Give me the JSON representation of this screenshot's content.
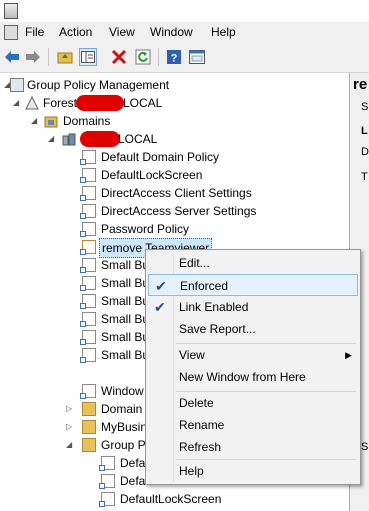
{
  "menu": {
    "file": "File",
    "action": "Action",
    "view": "View",
    "window": "Window",
    "help": "Help"
  },
  "toolbar_icons": [
    "back-arrow-icon",
    "forward-arrow-icon",
    "folder-up-icon",
    "show-hide-tree-icon",
    "delete-icon",
    "refresh-icon",
    "help-icon",
    "properties-icon"
  ],
  "tree": {
    "root": "Group Policy Management",
    "forest_prefix": "Forest",
    "forest_suffix": "LOCAL",
    "domains": "Domains",
    "domain_suffix": "LOCAL",
    "gpos": [
      "Default Domain Policy",
      "DefaultLockScreen",
      "DirectAccess Client Settings",
      "DirectAccess Server Settings",
      "Password Policy",
      "remove Teamviewer",
      "Small Bu",
      "Small Bu",
      "Small Bu",
      "Small Bu",
      "Small Bu",
      "Small Bu",
      "Window"
    ],
    "folders": [
      "Domain",
      "MyBusin",
      "Group P"
    ],
    "group_children": [
      "Defa",
      "Defa",
      "DefaultLockScreen"
    ]
  },
  "right_pane": {
    "title": "re",
    "letters": [
      "S",
      "L",
      "D",
      "T",
      "S"
    ]
  },
  "context_menu": {
    "edit": "Edit...",
    "enforced": "Enforced",
    "link_enabled": "Link Enabled",
    "save_report": "Save Report...",
    "view": "View",
    "new_window": "New Window from Here",
    "delete": "Delete",
    "rename": "Rename",
    "refresh": "Refresh",
    "help": "Help",
    "enforced_checked": true,
    "link_enabled_checked": true
  }
}
